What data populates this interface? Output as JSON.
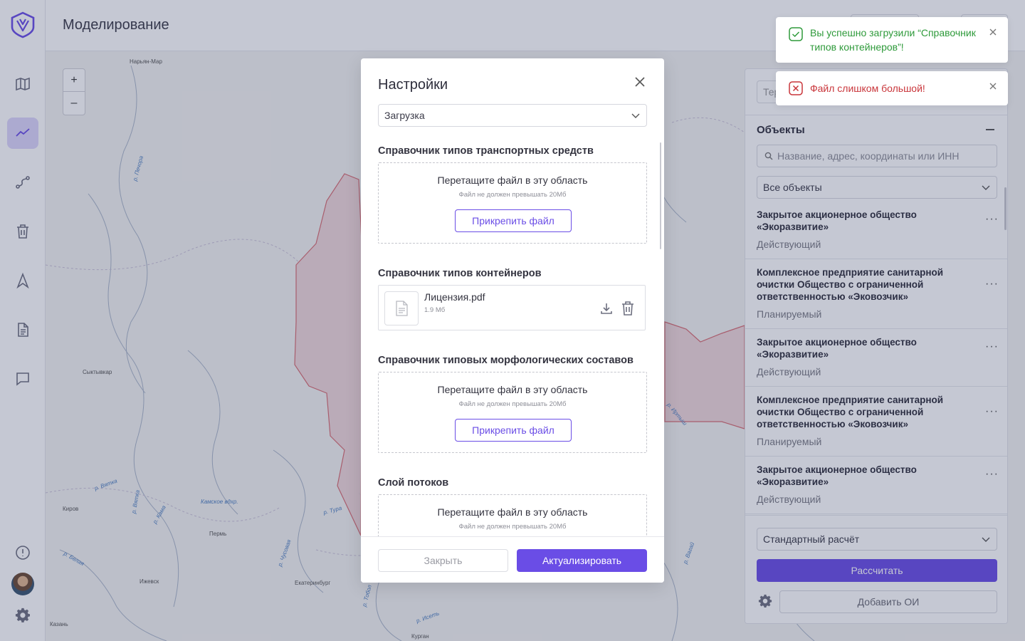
{
  "header": {
    "title": "Моделирование"
  },
  "sidebar": {
    "items": [
      {
        "icon": "map-icon",
        "active": false
      },
      {
        "icon": "chart-line-icon",
        "active": true
      },
      {
        "icon": "route-icon",
        "active": false
      },
      {
        "icon": "trash-icon",
        "active": false
      },
      {
        "icon": "navigation-icon",
        "active": false
      },
      {
        "icon": "document-icon",
        "active": false
      },
      {
        "icon": "chat-icon",
        "active": false
      }
    ]
  },
  "map": {
    "zoom_in": "+",
    "zoom_out": "–",
    "cities": [
      "Нарьян-Мар",
      "Сыктывкар",
      "Киров",
      "Пермь",
      "Ижевск",
      "Екатеринбург",
      "Казань",
      "Курган"
    ],
    "rivers": [
      "р. Печора",
      "р. Вятка",
      "р. Вятка",
      "р. Кама",
      "Камское вдхр.",
      "р. Тура",
      "р. Чусовая",
      "р. Белая",
      "р. Тобол",
      "р. Исеть",
      "р. Вагай",
      "р. Иртыш"
    ]
  },
  "modal": {
    "title": "Настройки",
    "select_value": "Загрузка",
    "sections": [
      {
        "title": "Справочник типов транспортных средств",
        "dropzone_text": "Перетащите файл в эту область",
        "hint": "Файл не должен превышать 20Мб",
        "button": "Прикрепить файл"
      },
      {
        "title": "Справочник типов контейнеров",
        "file_name": "Лицензия.pdf",
        "file_size": "1.9 Мб"
      },
      {
        "title": "Справочник типовых морфологических составов",
        "dropzone_text": "Перетащите файл в эту область",
        "hint": "Файл не должен превышать 20Мб",
        "button": "Прикрепить файл"
      },
      {
        "title": "Слой потоков",
        "dropzone_text": "Перетащите файл в эту область",
        "hint": "Файл не должен превышать 20Мб"
      }
    ],
    "close_label": "Закрыть",
    "update_label": "Актуализировать"
  },
  "panel": {
    "top_input_placeholder": "Тер",
    "objects_title": "Объекты",
    "search_placeholder": "Название, адрес, координаты или ИНН",
    "filter_value": "Все объекты",
    "items": [
      {
        "name": "Закрытое акционерное общество «Экоразвитие»",
        "status": "Действующий"
      },
      {
        "name": "Комплексное предприятие санитарной очистки Общество с ограниченной ответственностью «Эковозчик»",
        "status": "Планируемый"
      },
      {
        "name": "Закрытое акционерное общество «Экоразвитие»",
        "status": "Действующий"
      },
      {
        "name": "Комплексное предприятие санитарной очистки Общество с ограниченной ответственностью «Эковозчик»",
        "status": "Планируемый"
      },
      {
        "name": "Закрытое акционерное общество «Экоразвитие»",
        "status": "Действующий"
      }
    ],
    "more_label": "···",
    "calc_select": "Стандартный расчёт",
    "calc_button": "Рассчитать",
    "add_button": "Добавить ОИ"
  },
  "toasts": [
    {
      "type": "success",
      "text": "Вы успешно загрузили “Справочник типов контейнеров”!"
    },
    {
      "type": "error",
      "text": "Файл слишком большой!"
    }
  ],
  "colors": {
    "accent": "#6a4de6",
    "success": "#2e9a3a",
    "error": "#c9353a",
    "region_border": "#d65f67"
  }
}
